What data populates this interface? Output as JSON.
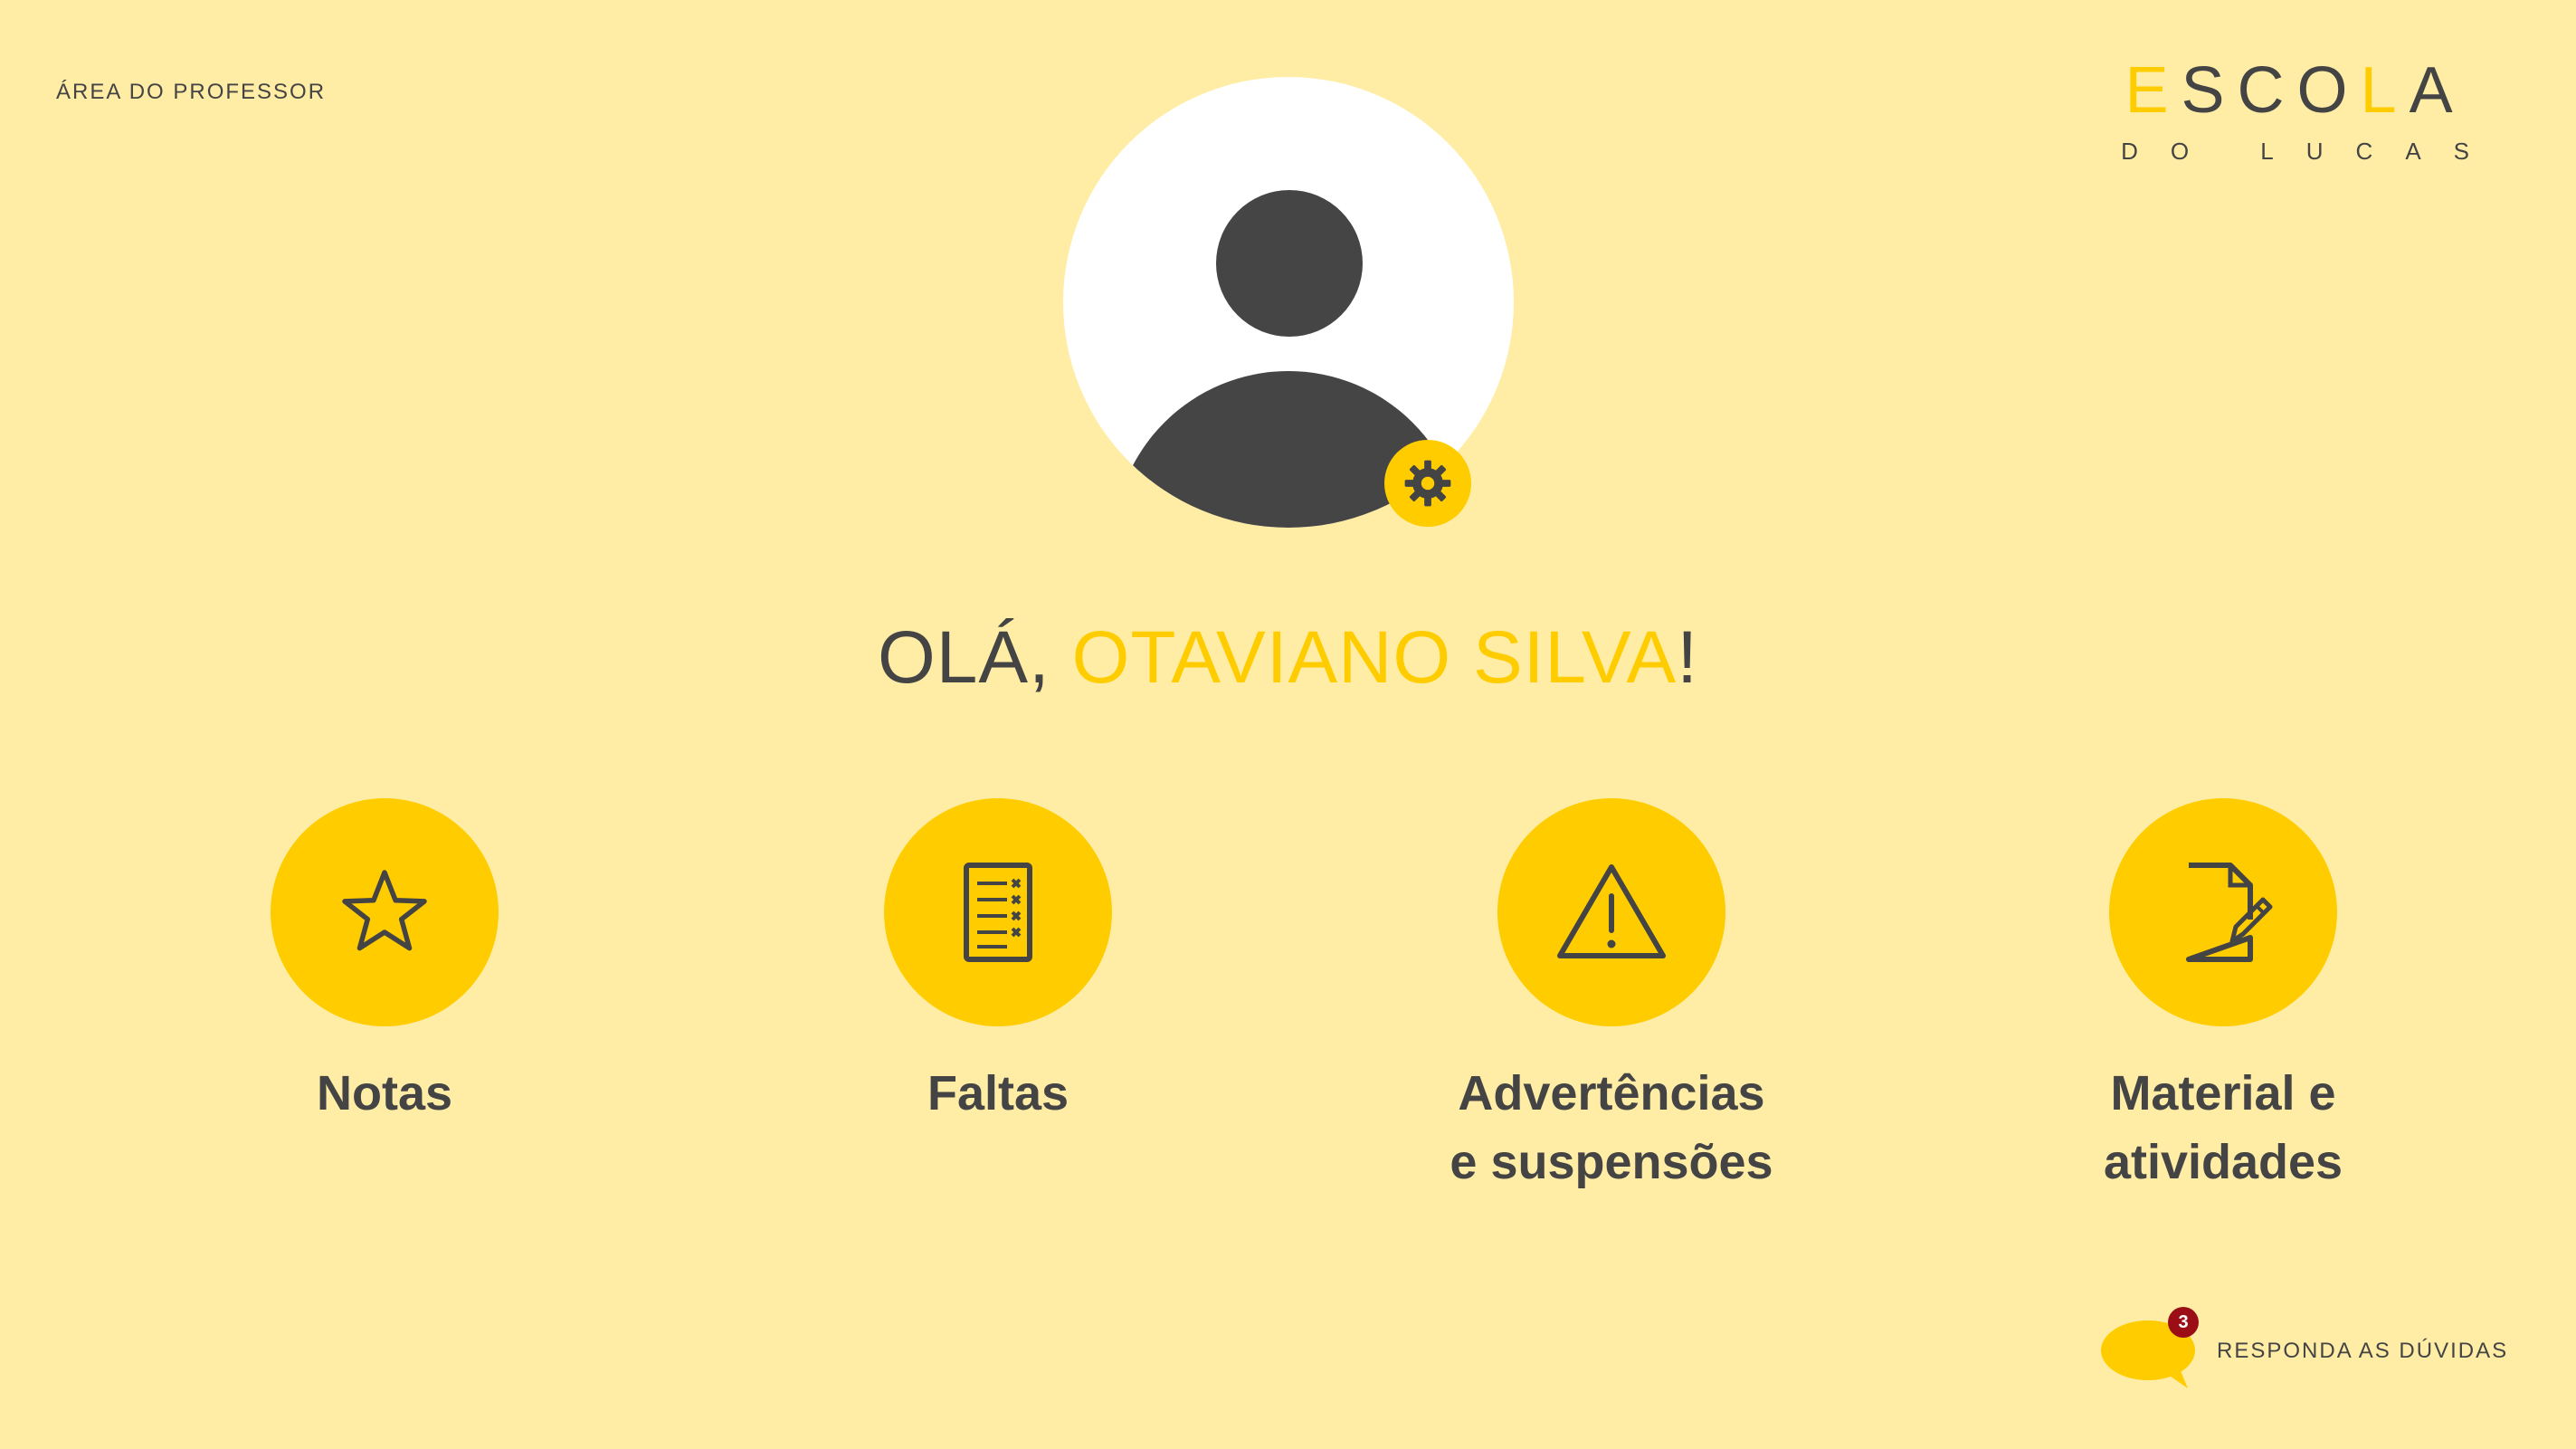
{
  "header": {
    "area_label": "ÁREA DO PROFESSOR",
    "logo": {
      "title_prefix": "E",
      "title_mid": "SCO",
      "title_l": "L",
      "title_end": "A",
      "subtitle": "DO LUCAS"
    }
  },
  "profile": {
    "greeting_prefix": "OLÁ, ",
    "user_name": "OTAVIANO SILVA",
    "greeting_suffix": "!"
  },
  "menu": {
    "items": [
      {
        "label": "Notas",
        "icon": "star-icon"
      },
      {
        "label": "Faltas",
        "icon": "checklist-icon"
      },
      {
        "label": "Advertências\ne suspensões",
        "icon": "warning-icon"
      },
      {
        "label": "Material e\natividades",
        "icon": "document-edit-icon"
      }
    ]
  },
  "help": {
    "badge_count": "3",
    "label": "RESPONDA AS DÚVIDAS"
  },
  "colors": {
    "background": "#FFEDA6",
    "accent": "#FFCC00",
    "text": "#444444",
    "badge": "#9B0E16"
  }
}
